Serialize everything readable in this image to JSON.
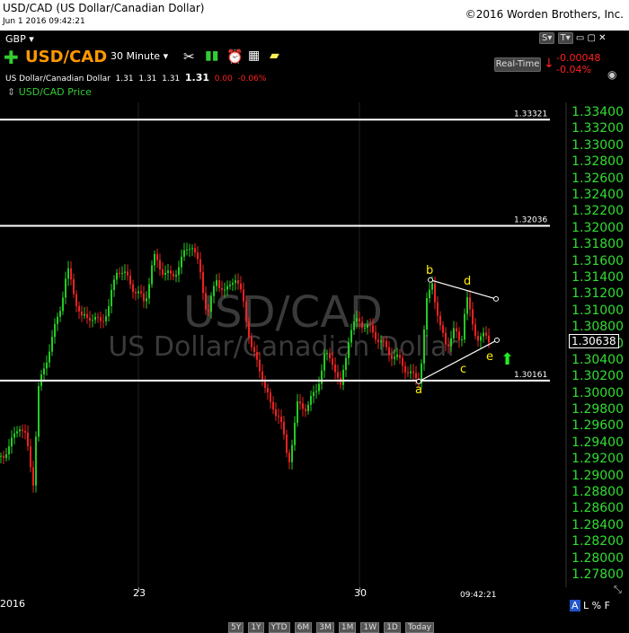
{
  "window": {
    "title": "USD/CAD (US Dollar/Canadian Dollar)",
    "datetime": "Jun 1 2016 09:42:21",
    "copyright": "©2016 Worden Brothers, Inc."
  },
  "toolbar": {
    "currency": "GBP",
    "symbol": "USD/CAD",
    "interval": "30 Minute",
    "description": "US Dollar/Canadian Dollar",
    "quote_values": [
      "1.31",
      "1.31",
      "1.31",
      "1.31"
    ],
    "change": "0.00",
    "change_pct": "-0.06%",
    "realtime_label": "Real-Time",
    "rt_change": "-0.00048",
    "rt_change_pct": "-0.04%",
    "indicator_label": "USD/CAD Price",
    "icons": [
      "plus-icon",
      "tools-icon",
      "bars-icon",
      "alarm-icon",
      "calculator-icon",
      "note-icon"
    ]
  },
  "chart": {
    "watermark_symbol": "USD/CAD",
    "watermark_name": "US Dollar/Canadian Dollar",
    "price_axis": [
      "1.33400",
      "1.33200",
      "1.33000",
      "1.32800",
      "1.32600",
      "1.32400",
      "1.32200",
      "1.32000",
      "1.31800",
      "1.31600",
      "1.31400",
      "1.31200",
      "1.31000",
      "1.30800",
      "1.30600",
      "1.30400",
      "1.30200",
      "1.30000",
      "1.29800",
      "1.29600",
      "1.29400",
      "1.29200",
      "1.29000",
      "1.28800",
      "1.28600",
      "1.28400",
      "1.28200",
      "1.28000",
      "1.27800"
    ],
    "current_price": "1.30638",
    "levels": [
      {
        "label": "1.33321",
        "value": 1.33321
      },
      {
        "label": "1.32036",
        "value": 1.32036
      },
      {
        "label": "1.30161",
        "value": 1.30161
      }
    ],
    "wave_labels": [
      "a",
      "b",
      "c",
      "d",
      "e"
    ],
    "date_labels": [
      "2016",
      "23",
      "30"
    ],
    "time_readout": "09:42:21",
    "bottom_controls": [
      "5Y",
      "1Y",
      "YTD",
      "6M",
      "3M",
      "1M",
      "1W",
      "1D",
      "Today"
    ],
    "right_controls": [
      "A",
      "L",
      "%",
      "F"
    ]
  }
}
